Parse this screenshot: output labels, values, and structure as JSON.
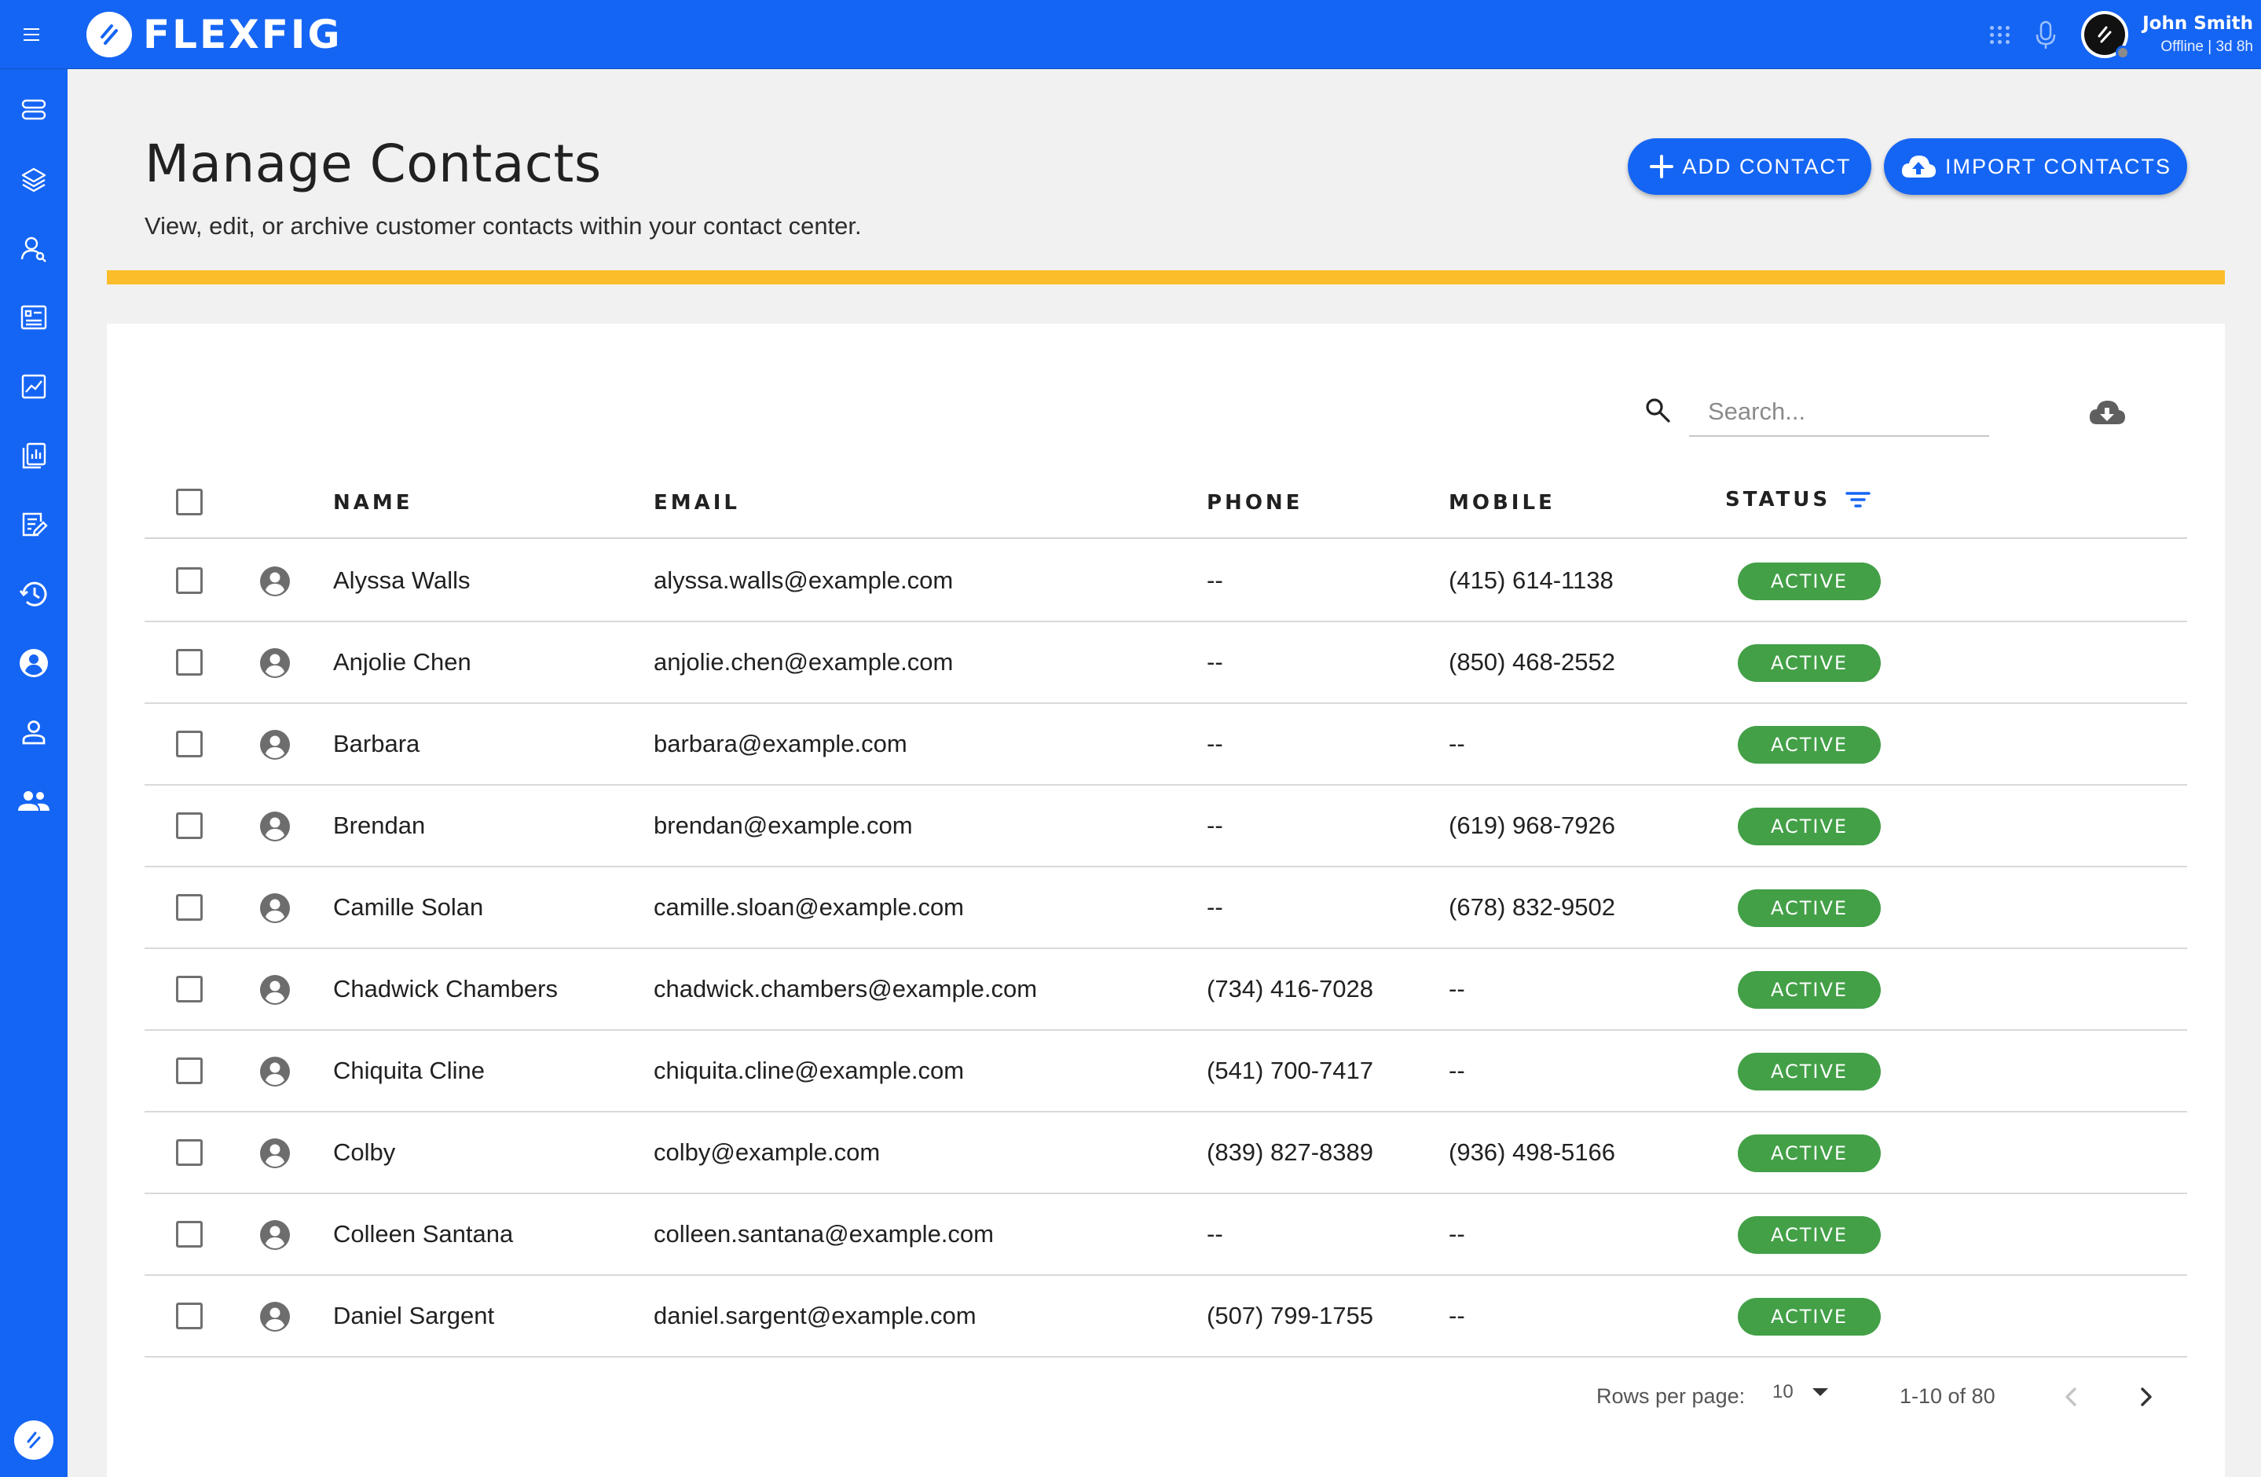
{
  "app": {
    "brand_name": "FLEXFIG",
    "user": {
      "name": "John Smith",
      "status": "Offline | 3d 8h"
    }
  },
  "sidebar": {
    "items": [
      {
        "icon": "servers-icon"
      },
      {
        "icon": "layers-icon"
      },
      {
        "icon": "contact-search-icon"
      },
      {
        "icon": "list-details-icon"
      },
      {
        "icon": "analytics-chart-icon"
      },
      {
        "icon": "reports-icon"
      },
      {
        "icon": "edit-document-icon"
      },
      {
        "icon": "history-icon"
      },
      {
        "icon": "account-circle-icon"
      },
      {
        "icon": "person-icon"
      },
      {
        "icon": "people-icon"
      }
    ]
  },
  "header": {
    "title": "Manage Contacts",
    "subtitle": "View, edit, or archive customer contacts within your contact center.",
    "add_button_label": "ADD CONTACT",
    "import_button_label": "IMPORT CONTACTS"
  },
  "colors": {
    "primary": "#1565f4",
    "accent_bar": "#fbbd2a",
    "status_active": "#43a047"
  },
  "search": {
    "placeholder": "Search..."
  },
  "table": {
    "columns": {
      "name": "NAME",
      "email": "EMAIL",
      "phone": "PHONE",
      "mobile": "MOBILE",
      "status": "STATUS"
    },
    "rows": [
      {
        "name": "Alyssa Walls",
        "email": "alyssa.walls@example.com",
        "phone": "--",
        "mobile": "(415) 614-1138",
        "status": "ACTIVE"
      },
      {
        "name": "Anjolie Chen",
        "email": "anjolie.chen@example.com",
        "phone": "--",
        "mobile": "(850) 468-2552",
        "status": "ACTIVE"
      },
      {
        "name": "Barbara",
        "email": "barbara@example.com",
        "phone": "--",
        "mobile": "--",
        "status": "ACTIVE"
      },
      {
        "name": "Brendan",
        "email": "brendan@example.com",
        "phone": "--",
        "mobile": "(619) 968-7926",
        "status": "ACTIVE"
      },
      {
        "name": "Camille Solan",
        "email": "camille.sloan@example.com",
        "phone": "--",
        "mobile": "(678) 832-9502",
        "status": "ACTIVE"
      },
      {
        "name": "Chadwick Chambers",
        "email": "chadwick.chambers@example.com",
        "phone": "(734) 416-7028",
        "mobile": "--",
        "status": "ACTIVE"
      },
      {
        "name": "Chiquita Cline",
        "email": "chiquita.cline@example.com",
        "phone": "(541) 700-7417",
        "mobile": "--",
        "status": "ACTIVE"
      },
      {
        "name": "Colby",
        "email": "colby@example.com",
        "phone": "(839) 827-8389",
        "mobile": "(936) 498-5166",
        "status": "ACTIVE"
      },
      {
        "name": "Colleen Santana",
        "email": "colleen.santana@example.com",
        "phone": "--",
        "mobile": "--",
        "status": "ACTIVE"
      },
      {
        "name": "Daniel Sargent",
        "email": "daniel.sargent@example.com",
        "phone": "(507) 799-1755",
        "mobile": "--",
        "status": "ACTIVE"
      }
    ]
  },
  "pagination": {
    "rows_per_page_label": "Rows per page:",
    "rows_per_page": "10",
    "range": "1-10 of 80"
  }
}
